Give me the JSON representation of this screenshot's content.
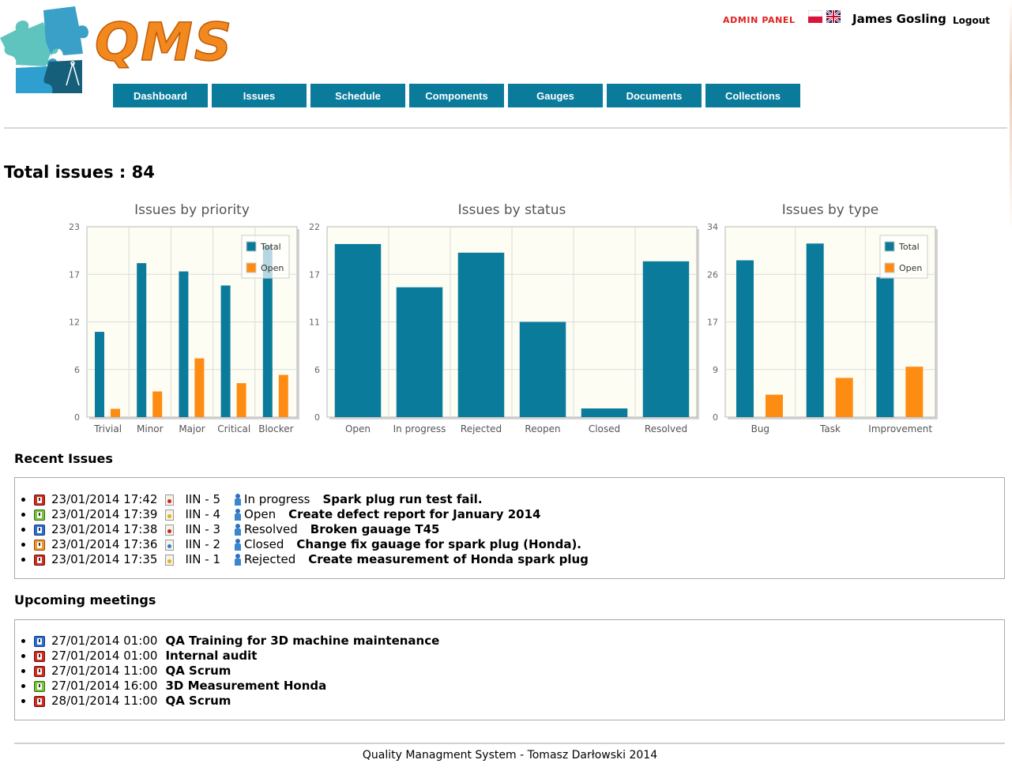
{
  "header": {
    "logo_text": "QMS",
    "admin_panel": "ADMIN PANEL",
    "user_name": "James Gosling",
    "logout": "Logout",
    "languages": [
      "pl-flag",
      "uk-flag"
    ]
  },
  "nav": {
    "items": [
      "Dashboard",
      "Issues",
      "Schedule",
      "Components",
      "Gauges",
      "Documents",
      "Collections"
    ],
    "color": "#0b7b9c"
  },
  "total_issues": "Total issues : 84",
  "chart_data": [
    {
      "type": "bar",
      "title": "Issues by priority",
      "categories": [
        "Trivial",
        "Minor",
        "Major",
        "Critical",
        "Blocker"
      ],
      "series": [
        {
          "name": "Total",
          "values": [
            10.3,
            18.6,
            17.6,
            15.9,
            20.7
          ],
          "color": "#0b7b9c"
        },
        {
          "name": "Open",
          "values": [
            1,
            3.1,
            7.1,
            4.1,
            5.1
          ],
          "color": "#ff8c12"
        }
      ],
      "yticks": [
        "0",
        "6",
        "12",
        "17",
        "23"
      ],
      "ylim": [
        0,
        23
      ],
      "legend": "top-right",
      "grid": true
    },
    {
      "type": "bar",
      "title": "Issues by status",
      "categories": [
        "Open",
        "In progress",
        "Rejected",
        "Reopen",
        "Closed",
        "Resolved"
      ],
      "series": [
        {
          "name": "Total",
          "values": [
            20,
            15,
            19,
            11,
            1,
            18
          ],
          "color": "#0b7b9c"
        }
      ],
      "yticks": [
        "0",
        "6",
        "11",
        "17",
        "22"
      ],
      "ylim": [
        0,
        22
      ],
      "legend": "none",
      "grid": true
    },
    {
      "type": "bar",
      "title": "Issues by type",
      "categories": [
        "Bug",
        "Task",
        "Improvement"
      ],
      "series": [
        {
          "name": "Total",
          "values": [
            28,
            31,
            25
          ],
          "color": "#0b7b9c"
        },
        {
          "name": "Open",
          "values": [
            4,
            7,
            9
          ],
          "color": "#ff8c12"
        }
      ],
      "yticks": [
        "0",
        "9",
        "17",
        "26",
        "34"
      ],
      "ylim": [
        0,
        34
      ],
      "legend": "top-right",
      "grid": true
    }
  ],
  "recent_issues": {
    "title": "Recent Issues",
    "items": [
      {
        "priority": "red",
        "date": "23/01/2014 17:42",
        "type": "bug",
        "iin": "IIN - 5",
        "status": "In progress",
        "title": "Spark plug run test fail."
      },
      {
        "priority": "green",
        "date": "23/01/2014 17:39",
        "type": "task",
        "iin": "IIN - 4",
        "status": "Open",
        "title": "Create defect report for January 2014"
      },
      {
        "priority": "blue",
        "date": "23/01/2014 17:38",
        "type": "bug",
        "iin": "IIN - 3",
        "status": "Resolved",
        "title": "Broken gauage T45"
      },
      {
        "priority": "orange",
        "date": "23/01/2014 17:36",
        "type": "improvement",
        "iin": "IIN - 2",
        "status": "Closed",
        "title": "Change fix gauage for spark plug (Honda)."
      },
      {
        "priority": "red",
        "date": "23/01/2014 17:35",
        "type": "task",
        "iin": "IIN - 1",
        "status": "Rejected",
        "title": "Create measurement of Honda spark plug"
      }
    ]
  },
  "upcoming_meetings": {
    "title": "Upcoming meetings",
    "items": [
      {
        "priority": "blue",
        "date": "27/01/2014 01:00",
        "title": "QA Training for 3D machine maintenance"
      },
      {
        "priority": "red",
        "date": "27/01/2014 01:00",
        "title": "Internal audit"
      },
      {
        "priority": "red",
        "date": "27/01/2014 11:00",
        "title": "QA Scrum"
      },
      {
        "priority": "green",
        "date": "27/01/2014 16:00",
        "title": "3D Measurement Honda"
      },
      {
        "priority": "red",
        "date": "28/01/2014 11:00",
        "title": "QA Scrum"
      }
    ]
  },
  "footer": "Quality Managment System - Tomasz Darłowski 2014"
}
